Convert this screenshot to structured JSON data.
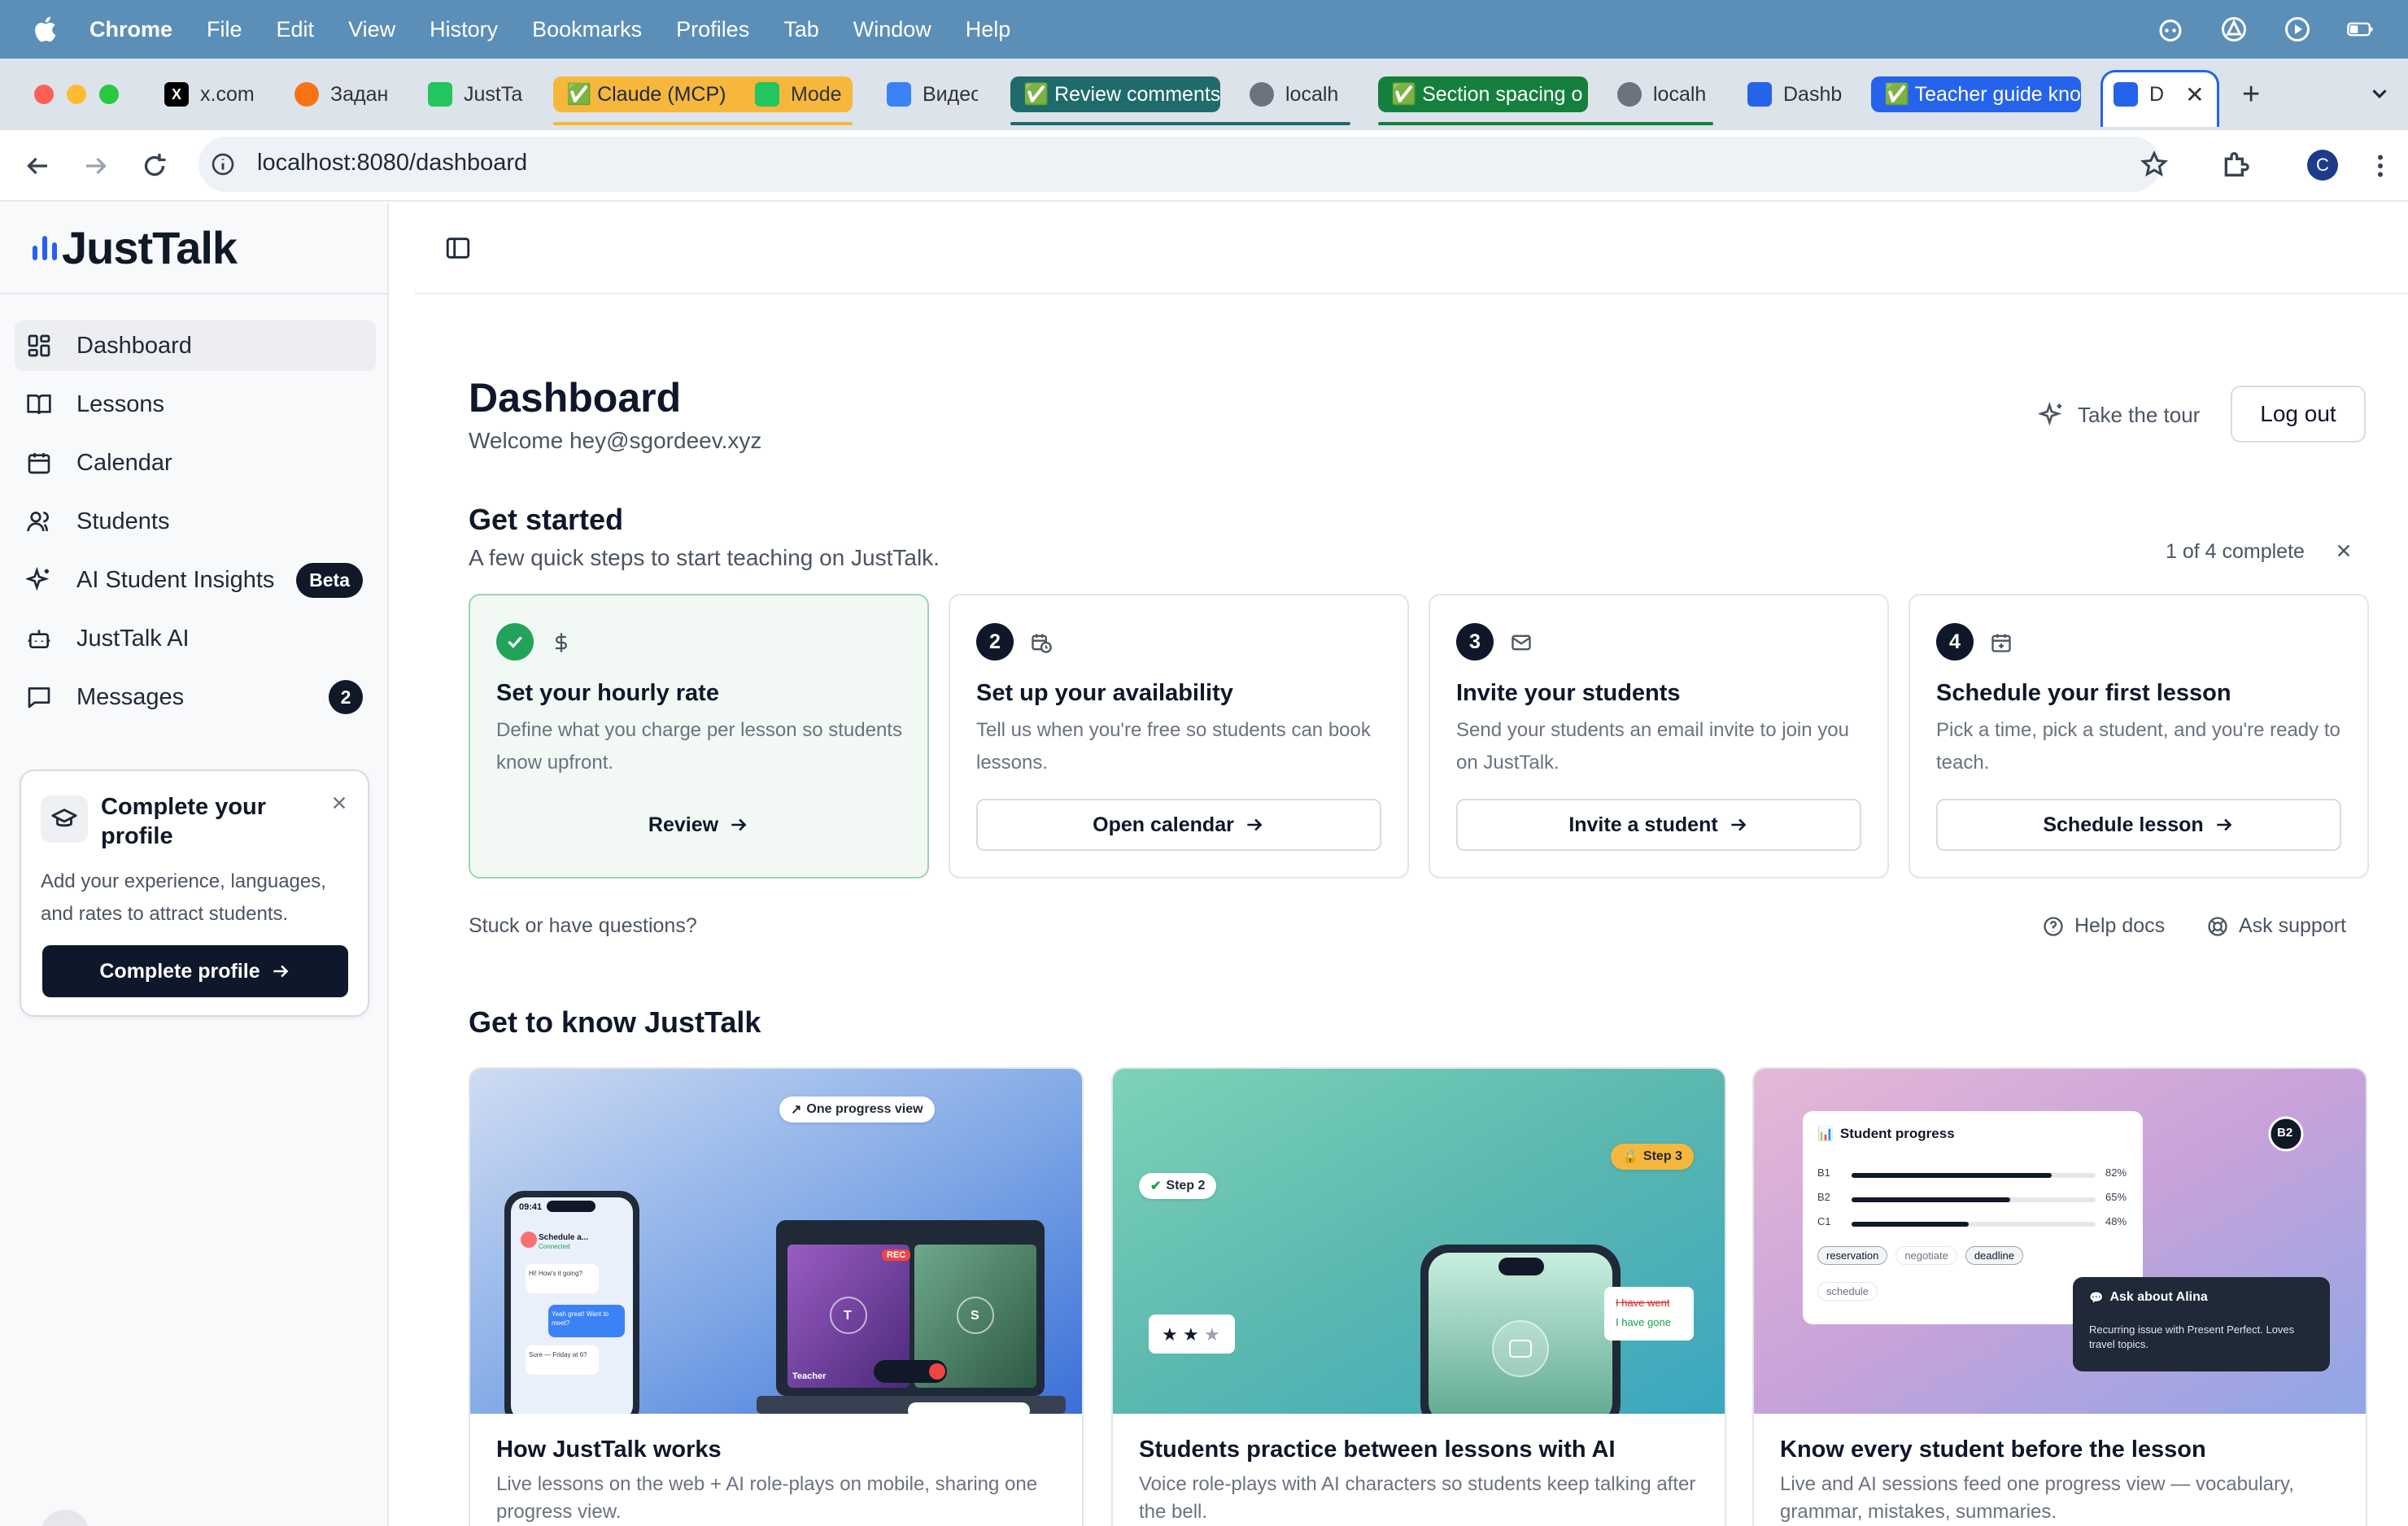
{
  "menubar": {
    "app": "Chrome",
    "items": [
      "File",
      "Edit",
      "View",
      "History",
      "Bookmarks",
      "Profiles",
      "Tab",
      "Window",
      "Help"
    ]
  },
  "tabs": {
    "t1": "x.com",
    "t2": "Задан",
    "t3": "JustTa",
    "t4": "✅ Claude (MCP)",
    "t5": "Mode",
    "t6": "Видео",
    "t7": "✅ Review comments",
    "t8": "localh",
    "t9": "✅ Section spacing o",
    "t10": "localh",
    "t11": "Dashb",
    "t12": "✅ Teacher guide kno",
    "t13": "D",
    "new_tab": "+"
  },
  "address": {
    "url": "localhost:8080/dashboard",
    "profile_initial": "C"
  },
  "sidebar": {
    "brand": "JustTalk",
    "items": [
      {
        "label": "Dashboard"
      },
      {
        "label": "Lessons"
      },
      {
        "label": "Calendar"
      },
      {
        "label": "Students"
      },
      {
        "label": "AI Student Insights",
        "badge": "Beta"
      },
      {
        "label": "JustTalk AI"
      },
      {
        "label": "Messages",
        "count": "2"
      }
    ],
    "profile_card": {
      "title": "Complete your profile",
      "text": "Add your experience, languages, and rates to attract students.",
      "button": "Complete profile"
    }
  },
  "header": {
    "title": "Dashboard",
    "welcome": "Welcome hey@sgordeev.xyz",
    "tour": "Take the tour",
    "logout": "Log out"
  },
  "get_started": {
    "title": "Get started",
    "subtitle": "A few quick steps to start teaching on JustTalk.",
    "progress": "1 of 4 complete",
    "steps": [
      {
        "num": "",
        "title": "Set your hourly rate",
        "desc": "Define what you charge per lesson so students know upfront.",
        "button": "Review"
      },
      {
        "num": "2",
        "title": "Set up your availability",
        "desc": "Tell us when you're free so students can book lessons.",
        "button": "Open calendar"
      },
      {
        "num": "3",
        "title": "Invite your students",
        "desc": "Send your students an email invite to join you on JustTalk.",
        "button": "Invite a student"
      },
      {
        "num": "4",
        "title": "Schedule your first lesson",
        "desc": "Pick a time, pick a student, and you're ready to teach.",
        "button": "Schedule lesson"
      }
    ],
    "stuck": "Stuck or have questions?",
    "help_docs": "Help docs",
    "ask_support": "Ask support"
  },
  "know": {
    "title": "Get to know JustTalk",
    "cards": [
      {
        "title": "How JustTalk works",
        "desc": "Live lessons on the web + AI role-plays on mobile, sharing one progress view.",
        "pill": "One progress view",
        "phone_time": "09:41",
        "phone_header": "Schedule a...",
        "phone_status": "Connected",
        "phone_msgs": [
          "Hi! How's it going?",
          "Yeah great! Want to meet?",
          "Sure — Friday at 6?"
        ],
        "rec": "REC",
        "avatar_t": "T",
        "avatar_s": "S",
        "teacher": "Teacher"
      },
      {
        "title": "Students practice between lessons with AI",
        "desc": "Voice role-plays with AI characters so students keep talking after the bell.",
        "step2": "Step 2",
        "step3": "Step 3",
        "wrong": "I have went",
        "right": "I have gone"
      },
      {
        "title": "Know every student before the lesson",
        "desc": "Live and AI sessions feed one progress view — vocabulary, grammar, mistakes, summaries.",
        "panel_title": "Student progress",
        "level_badge": "B2",
        "levels": [
          {
            "label": "B1",
            "pct": "82%",
            "value": 82
          },
          {
            "label": "B2",
            "pct": "65%",
            "value": 65
          },
          {
            "label": "C1",
            "pct": "48%",
            "value": 48
          }
        ],
        "tags": [
          "reservation",
          "negotiate",
          "deadline",
          "schedule"
        ],
        "ask_title": "Ask about Alina",
        "ask_text": "Recurring issue with Present Perfect. Loves travel topics."
      }
    ]
  },
  "colors": {
    "accent": "#2563eb",
    "dark": "#0f172a",
    "success": "#22a35a",
    "menubar": "#5b8fb8"
  }
}
